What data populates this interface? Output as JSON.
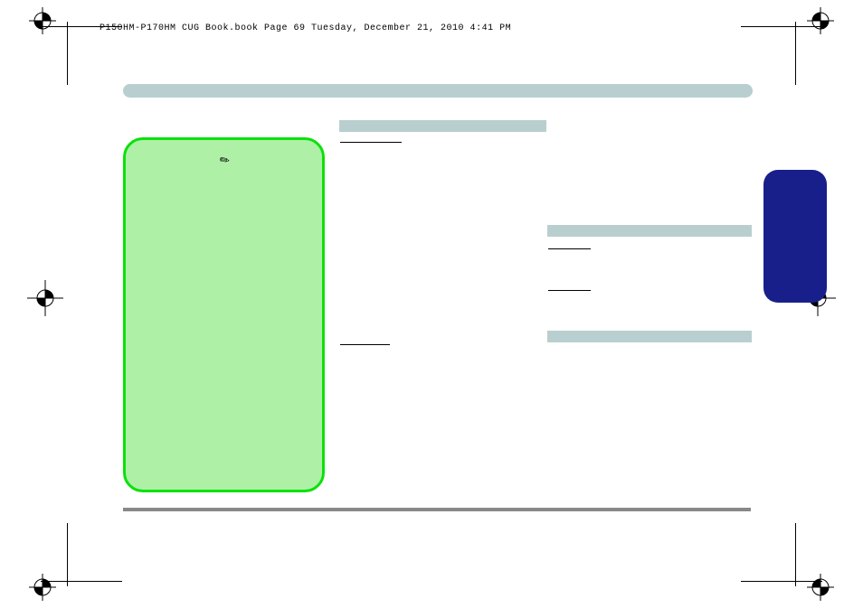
{
  "header": {
    "source_line": "P150HM-P170HM CUG Book.book  Page 69  Tuesday, December 21, 2010  4:41 PM"
  }
}
